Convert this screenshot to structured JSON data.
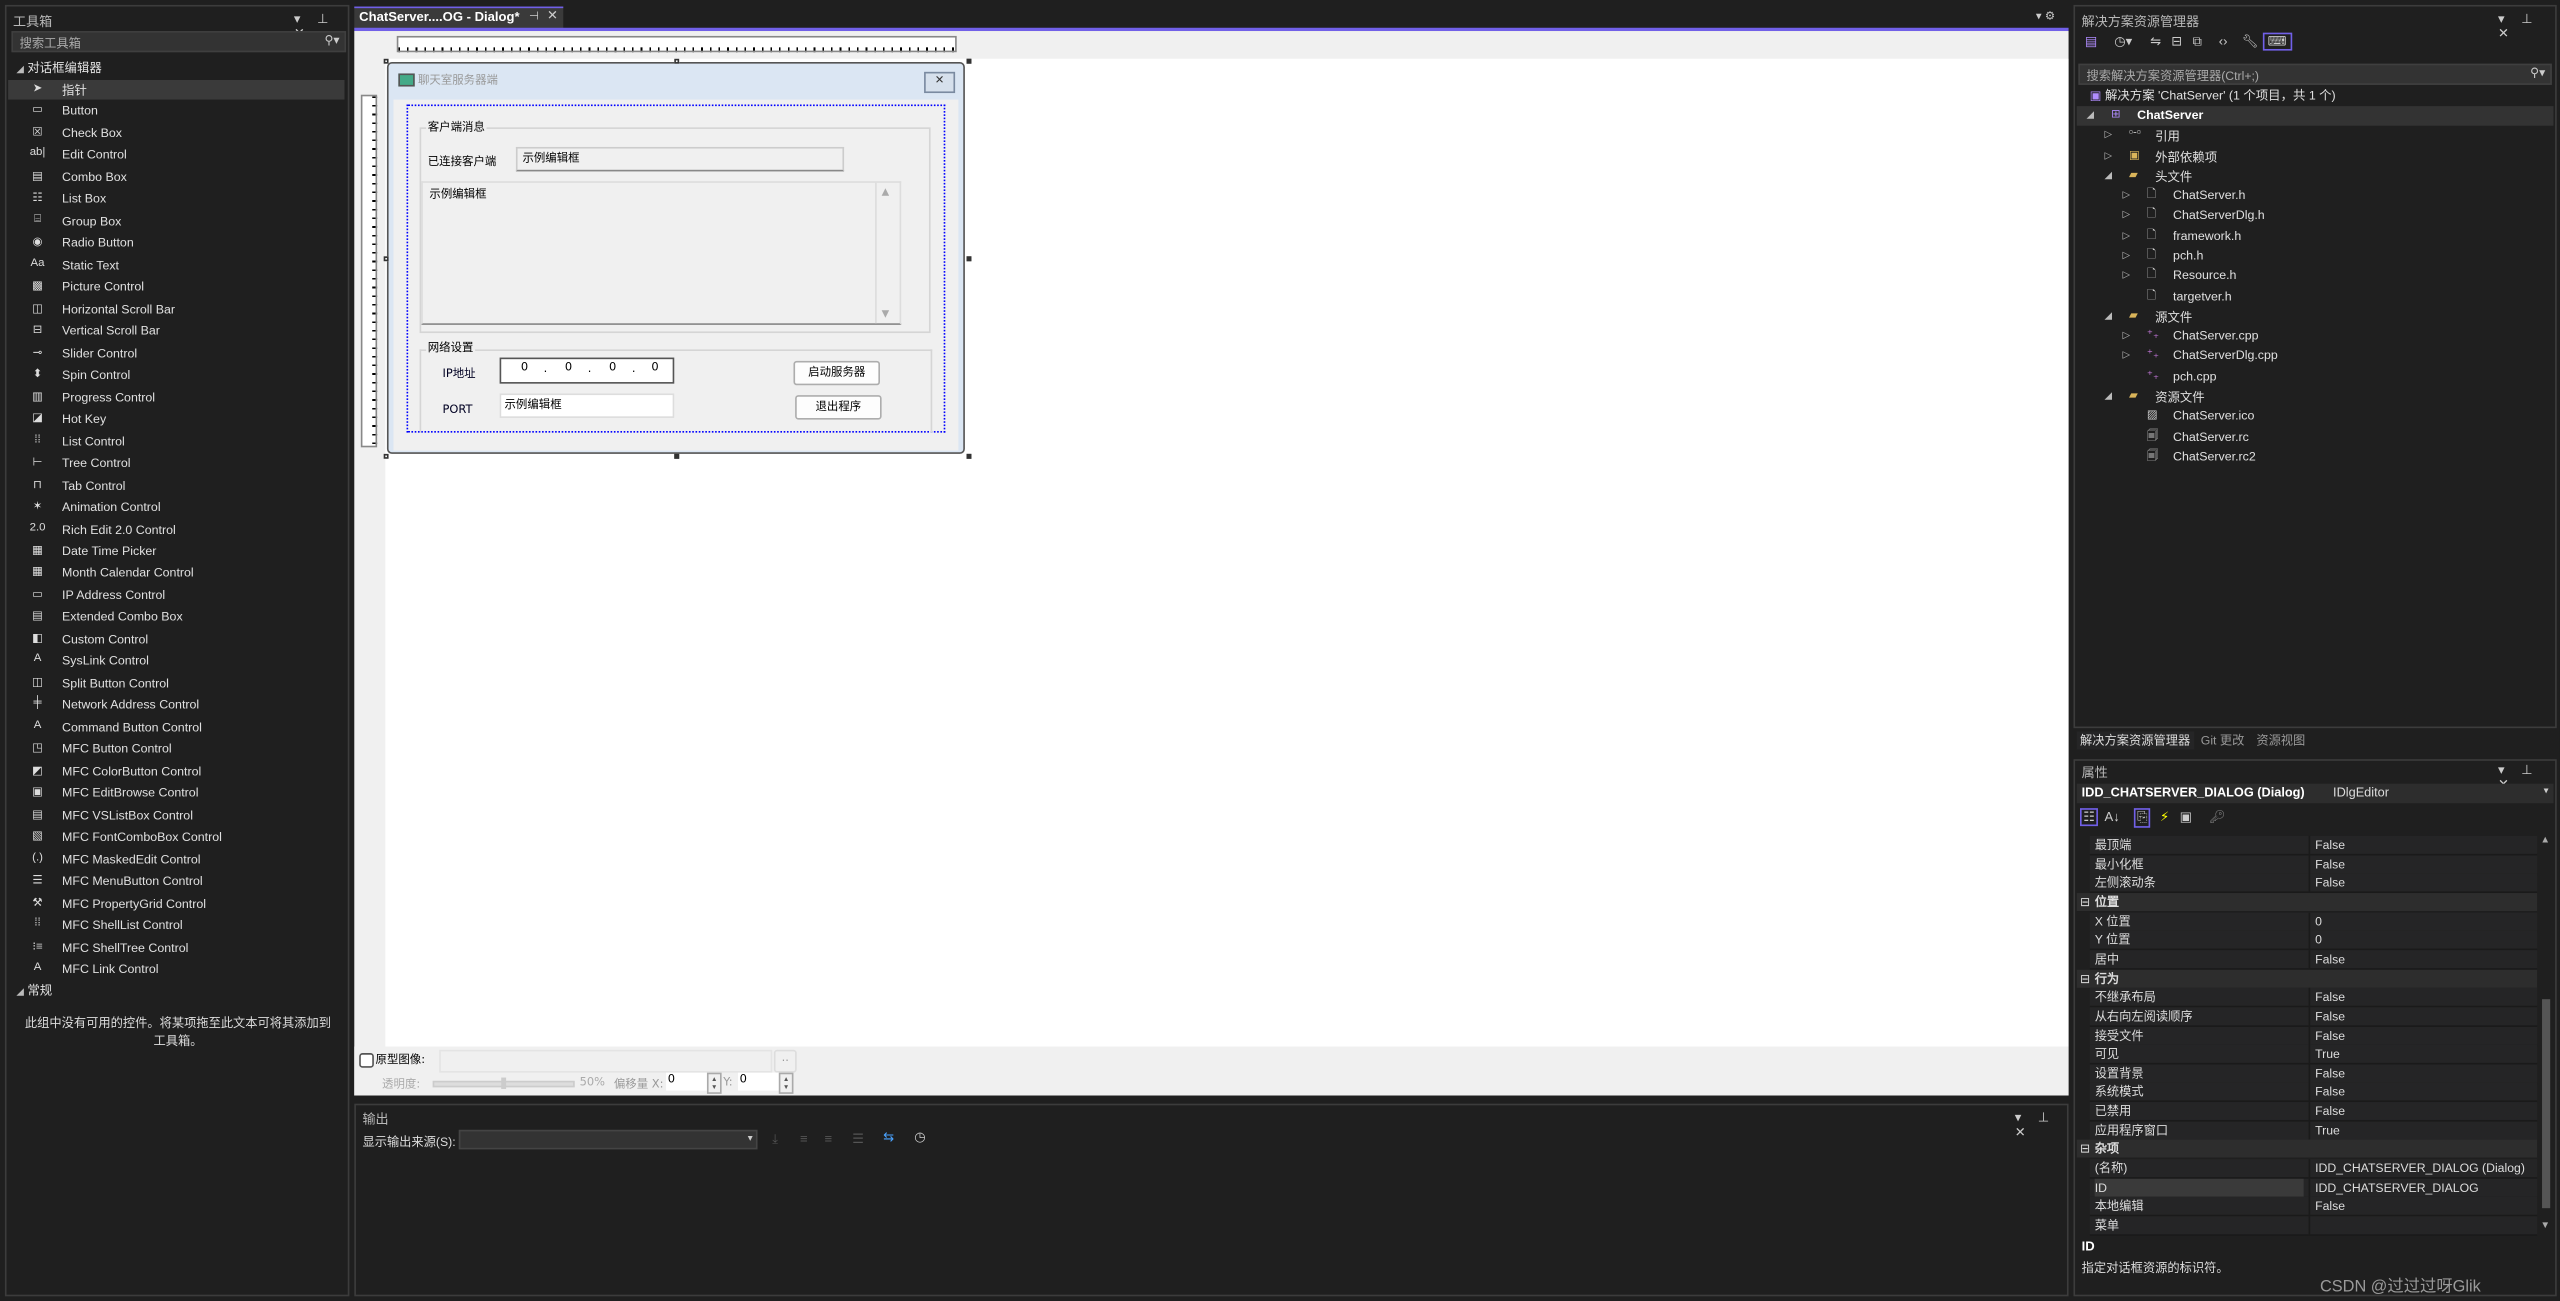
{
  "toolbox": {
    "title": "工具箱",
    "search_placeholder": "搜索工具箱",
    "group_dialog": "对话框编辑器",
    "items": [
      {
        "label": "指针",
        "icon": "pointer-icon"
      },
      {
        "label": "Button",
        "icon": "button-icon"
      },
      {
        "label": "Check Box",
        "icon": "checkbox-icon"
      },
      {
        "label": "Edit Control",
        "icon": "edit-icon"
      },
      {
        "label": "Combo Box",
        "icon": "combobox-icon"
      },
      {
        "label": "List Box",
        "icon": "listbox-icon"
      },
      {
        "label": "Group Box",
        "icon": "groupbox-icon"
      },
      {
        "label": "Radio Button",
        "icon": "radio-icon"
      },
      {
        "label": "Static Text",
        "icon": "static-text-icon"
      },
      {
        "label": "Picture Control",
        "icon": "picture-icon"
      },
      {
        "label": "Horizontal Scroll Bar",
        "icon": "hscroll-icon"
      },
      {
        "label": "Vertical Scroll Bar",
        "icon": "vscroll-icon"
      },
      {
        "label": "Slider Control",
        "icon": "slider-icon"
      },
      {
        "label": "Spin Control",
        "icon": "spin-icon"
      },
      {
        "label": "Progress Control",
        "icon": "progress-icon"
      },
      {
        "label": "Hot Key",
        "icon": "hotkey-icon"
      },
      {
        "label": "List Control",
        "icon": "list-control-icon"
      },
      {
        "label": "Tree Control",
        "icon": "tree-icon"
      },
      {
        "label": "Tab Control",
        "icon": "tab-icon"
      },
      {
        "label": "Animation Control",
        "icon": "animation-icon"
      },
      {
        "label": "Rich Edit 2.0 Control",
        "icon": "richedit-icon"
      },
      {
        "label": "Date Time Picker",
        "icon": "datetime-icon"
      },
      {
        "label": "Month Calendar Control",
        "icon": "calendar-icon"
      },
      {
        "label": "IP Address Control",
        "icon": "ip-address-icon"
      },
      {
        "label": "Extended Combo Box",
        "icon": "ext-combo-icon"
      },
      {
        "label": "Custom Control",
        "icon": "custom-icon"
      },
      {
        "label": "SysLink Control",
        "icon": "syslink-icon"
      },
      {
        "label": "Split Button Control",
        "icon": "split-button-icon"
      },
      {
        "label": "Network Address Control",
        "icon": "network-icon"
      },
      {
        "label": "Command Button Control",
        "icon": "command-button-icon"
      },
      {
        "label": "MFC Button Control",
        "icon": "mfc-button-icon"
      },
      {
        "label": "MFC ColorButton Control",
        "icon": "color-button-icon"
      },
      {
        "label": "MFC EditBrowse Control",
        "icon": "edit-browse-icon"
      },
      {
        "label": "MFC VSListBox Control",
        "icon": "vslistbox-icon"
      },
      {
        "label": "MFC FontComboBox Control",
        "icon": "font-combo-icon"
      },
      {
        "label": "MFC MaskedEdit Control",
        "icon": "masked-edit-icon"
      },
      {
        "label": "MFC MenuButton Control",
        "icon": "menu-button-icon"
      },
      {
        "label": "MFC PropertyGrid Control",
        "icon": "wrench-icon"
      },
      {
        "label": "MFC ShellList Control",
        "icon": "shell-list-icon"
      },
      {
        "label": "MFC ShellTree Control",
        "icon": "shell-tree-icon"
      },
      {
        "label": "MFC Link Control",
        "icon": "link-icon"
      }
    ],
    "group_general": "常规",
    "empty_message": "此组中没有可用的控件。将某项拖至此文本可将其添加到工具箱。"
  },
  "editor": {
    "tab_label": "ChatServer....OG - Dialog*",
    "dialog": {
      "title": "聊天室服务器端",
      "group_clients": "客户端消息",
      "connected_label": "已连接客户端",
      "connected_value": "示例编辑框",
      "messages_value": "示例编辑框",
      "group_network": "网络设置",
      "ip_label": "IP地址",
      "ip_octets": [
        "0",
        "0",
        "0",
        "0"
      ],
      "port_label": "PORT",
      "port_value": "示例编辑框",
      "start_button": "启动服务器",
      "exit_button": "退出程序"
    },
    "prototype": {
      "checkbox_label": "原型图像:",
      "browse": "..",
      "opacity_label": "透明度:",
      "opacity_value": "50%",
      "opacity_fraction": 0.5,
      "offset_label": "偏移量 X:",
      "offset_x": "0",
      "y_label": "Y:",
      "offset_y": "0"
    }
  },
  "output": {
    "title": "输出",
    "source_label": "显示输出来源(S):",
    "source_value": ""
  },
  "solution_explorer": {
    "title": "解决方案资源管理器",
    "search_placeholder": "搜索解决方案资源管理器(Ctrl+;)",
    "solution_label": "解决方案 'ChatServer' (1 个项目，共 1 个)",
    "tree": [
      {
        "label": "ChatServer",
        "level": 0,
        "expander": "open",
        "icon": "project-icon",
        "bold": true
      },
      {
        "label": "引用",
        "level": 1,
        "expander": "closed",
        "icon": "references-icon"
      },
      {
        "label": "外部依赖项",
        "level": 1,
        "expander": "closed",
        "icon": "external-deps-icon"
      },
      {
        "label": "头文件",
        "level": 1,
        "expander": "open",
        "icon": "filter-folder-icon"
      },
      {
        "label": "ChatServer.h",
        "level": 2,
        "expander": "closed",
        "icon": "header-file-icon"
      },
      {
        "label": "ChatServerDlg.h",
        "level": 2,
        "expander": "closed",
        "icon": "header-file-icon"
      },
      {
        "label": "framework.h",
        "level": 2,
        "expander": "closed",
        "icon": "header-file-icon"
      },
      {
        "label": "pch.h",
        "level": 2,
        "expander": "closed",
        "icon": "header-file-icon"
      },
      {
        "label": "Resource.h",
        "level": 2,
        "expander": "closed",
        "icon": "header-file-icon"
      },
      {
        "label": "targetver.h",
        "level": 2,
        "expander": "none",
        "icon": "header-file-icon"
      },
      {
        "label": "源文件",
        "level": 1,
        "expander": "open",
        "icon": "filter-folder-icon"
      },
      {
        "label": "ChatServer.cpp",
        "level": 2,
        "expander": "closed",
        "icon": "cpp-file-icon"
      },
      {
        "label": "ChatServerDlg.cpp",
        "level": 2,
        "expander": "closed",
        "icon": "cpp-file-icon"
      },
      {
        "label": "pch.cpp",
        "level": 2,
        "expander": "none",
        "icon": "cpp-file-icon"
      },
      {
        "label": "资源文件",
        "level": 1,
        "expander": "open",
        "icon": "filter-folder-icon"
      },
      {
        "label": "ChatServer.ico",
        "level": 2,
        "expander": "none",
        "icon": "image-file-icon"
      },
      {
        "label": "ChatServer.rc",
        "level": 2,
        "expander": "none",
        "icon": "resource-file-icon"
      },
      {
        "label": "ChatServer.rc2",
        "level": 2,
        "expander": "none",
        "icon": "resource-file-icon"
      }
    ],
    "tabs": [
      "解决方案资源管理器",
      "Git 更改",
      "资源视图"
    ]
  },
  "properties": {
    "title": "属性",
    "object_name": "IDD_CHATSERVER_DIALOG (Dialog)",
    "object_type": "IDlgEditor",
    "rows": [
      {
        "key": "最顶端",
        "value": "False"
      },
      {
        "key": "最小化框",
        "value": "False"
      },
      {
        "key": "左侧滚动条",
        "value": "False"
      },
      {
        "category": "位置"
      },
      {
        "key": "X 位置",
        "value": "0"
      },
      {
        "key": "Y 位置",
        "value": "0"
      },
      {
        "key": "居中",
        "value": "False"
      },
      {
        "category": "行为"
      },
      {
        "key": "不继承布局",
        "value": "False"
      },
      {
        "key": "从右向左阅读顺序",
        "value": "False"
      },
      {
        "key": "接受文件",
        "value": "False"
      },
      {
        "key": "可见",
        "value": "True"
      },
      {
        "key": "设置背景",
        "value": "False"
      },
      {
        "key": "系统模式",
        "value": "False"
      },
      {
        "key": "已禁用",
        "value": "False"
      },
      {
        "key": "应用程序窗口",
        "value": "True"
      },
      {
        "category": "杂项"
      },
      {
        "key": "(名称)",
        "value": "IDD_CHATSERVER_DIALOG (Dialog)"
      },
      {
        "key": "ID",
        "value": "IDD_CHATSERVER_DIALOG",
        "selected": true
      },
      {
        "key": "本地编辑",
        "value": "False"
      },
      {
        "key": "菜单",
        "value": ""
      }
    ],
    "description_title": "ID",
    "description_text": "指定对话框资源的标识符。"
  },
  "watermark": "CSDN @过过过呀Glik",
  "colors": {
    "accent": "#7160e8",
    "selection_blue": "#0000ff"
  }
}
